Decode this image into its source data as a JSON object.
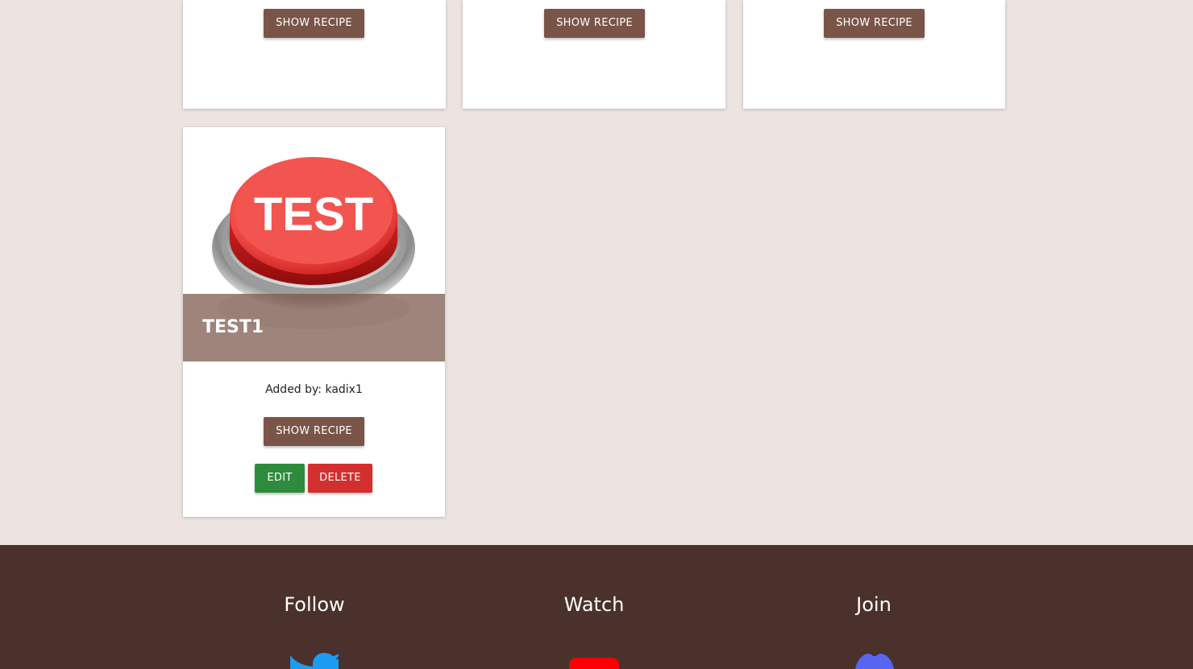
{
  "recipe_grid": {
    "top_row": [
      {
        "show_label": "SHOW RECIPE"
      },
      {
        "show_label": "SHOW RECIPE"
      },
      {
        "show_label": "SHOW RECIPE"
      }
    ],
    "featured_card": {
      "image_text": "TEST",
      "title": "TEST1",
      "added_by": "Added by: kadix1",
      "show_label": "SHOW RECIPE",
      "edit_label": "EDIT",
      "delete_label": "DELETE"
    }
  },
  "footer": {
    "columns": [
      {
        "heading": "Follow",
        "icon": "twitter-icon"
      },
      {
        "heading": "Watch",
        "icon": "youtube-icon"
      },
      {
        "heading": "Join",
        "icon": "discord-icon"
      }
    ]
  },
  "colors": {
    "page_bg": "#ede4e2",
    "brown_button": "#795548",
    "edit_button": "#2e8b3d",
    "delete_button": "#d32f2f",
    "footer_bg": "#4a312c",
    "twitter": "#1d9bf0",
    "youtube": "#ff0000",
    "discord": "#5865f2"
  }
}
